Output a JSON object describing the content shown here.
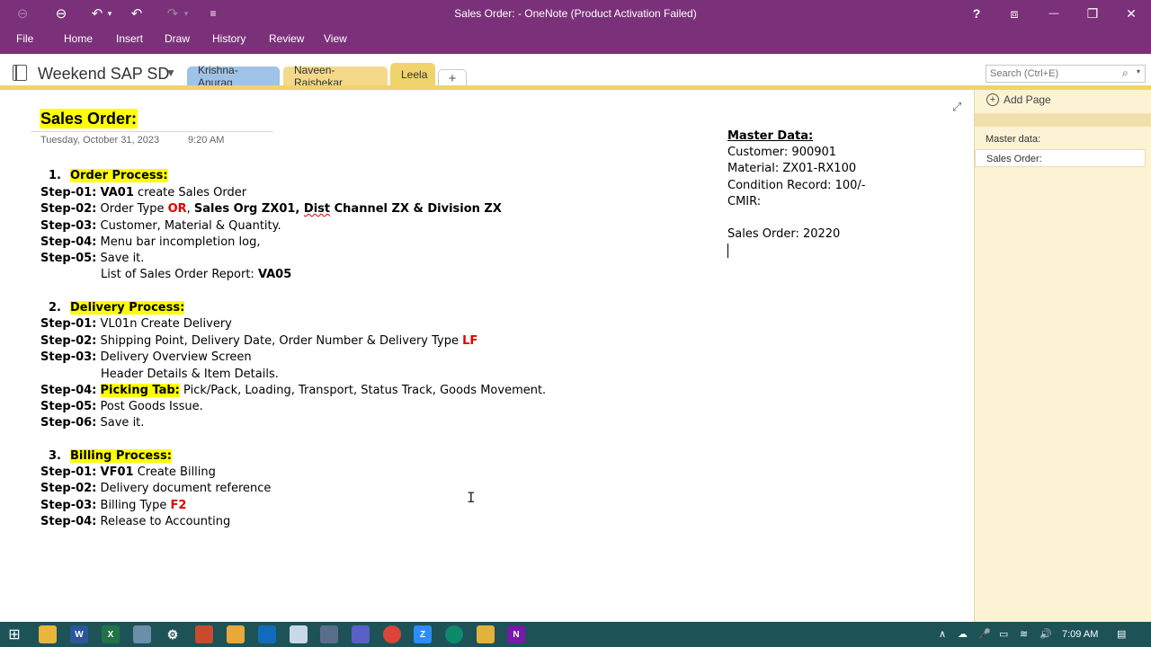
{
  "window": {
    "title": "Sales Order: - OneNote (Product Activation Failed)",
    "help_icon": "?",
    "restore_ribbon_icon": "⧈",
    "minimize_icon": "—",
    "maximize_icon": "❐",
    "close_icon": "✕"
  },
  "qat": {
    "back": "⊖",
    "undo": "↶",
    "undo_dd": "▾",
    "undo2": "↶",
    "redo": "↷",
    "redo_dd": "▾",
    "customize": "≡"
  },
  "ribbon": {
    "tabs": [
      "File",
      "Home",
      "Insert",
      "Draw",
      "History",
      "Review",
      "View"
    ]
  },
  "notebook": {
    "name": "Weekend SAP SD",
    "dropdown": "▼",
    "sections": [
      {
        "label": "Krishna-Anurag",
        "color": "#9fc3e6"
      },
      {
        "label": "Naveen-Rajshekar",
        "color": "#f4d98b"
      },
      {
        "label": "Leela",
        "color": "#f0d36b"
      }
    ],
    "add_section": "+"
  },
  "search": {
    "placeholder": "Search (Ctrl+E)",
    "icon": "⌕",
    "dropdown": "▾"
  },
  "page": {
    "expand_icon": "⤢",
    "title": "Sales Order:",
    "date": "Tuesday, October 31, 2023",
    "time": "9:20 AM",
    "order_num": "1.",
    "order_heading": "Order Process:",
    "s1_label": "Step-01:",
    "s1_code": "VA01",
    "s1_text": " create Sales Order",
    "s2_label": "Step-02:",
    "s2_a": " Order Type ",
    "s2_or": "OR",
    "s2_b": ", ",
    "s2_c": "Sales Org ZX01, ",
    "s2_d": "Dist",
    "s2_e": " Channel ZX & Division ZX",
    "s3_label": "Step-03:",
    "s3_text": " Customer, Material  & Quantity.",
    "s4_label": "Step-04:",
    "s4_text": " Menu bar incompletion log,",
    "s5_label": "Step-05:",
    "s5_text": " Save it.",
    "s5_sub": "List of Sales Order Report: ",
    "s5_sub_code": "VA05",
    "delivery_num": "2.",
    "delivery_heading": "Delivery Process:",
    "d1_label": "Step-01:",
    "d1_text": " VL01n Create Delivery",
    "d2_label": "Step-02:",
    "d2_text": " Shipping Point, Delivery Date, Order Number & Delivery Type ",
    "d2_lf": "LF",
    "d3_label": "Step-03:",
    "d3_text": " Delivery Overview Screen",
    "d3_sub": "Header Details & Item Details.",
    "d4_label": "Step-04:",
    "d4_hl": "Picking Tab:",
    "d4_text": " Pick/Pack, Loading, Transport, Status Track, Goods Movement.",
    "d5_label": "Step-05:",
    "d5_text": " Post Goods Issue.",
    "d6_label": "Step-06:",
    "d6_text": " Save it.",
    "billing_num": "3.",
    "billing_heading": "Billing Process:",
    "b1_label": "Step-01:",
    "b1_code": "VF01",
    "b1_text": " Create Billing",
    "b2_label": "Step-02:",
    "b2_text": " Delivery document reference",
    "b3_label": "Step-03:",
    "b3_text": " Billing Type ",
    "b3_f2": "F2",
    "b4_label": "Step-04:",
    "b4_text": " Release to Accounting"
  },
  "master": {
    "title": "Master Data:",
    "customer": "Customer: 900901",
    "material": "Material: ZX01-RX100",
    "condition": "Condition Record: 100/-",
    "cmir": "CMIR:",
    "sales_order": "Sales Order: 20220"
  },
  "pages_panel": {
    "add_icon": "+",
    "add_page": "Add Page",
    "items": [
      "Master data:",
      "Sales Order:"
    ]
  },
  "taskbar": {
    "start": "⊞",
    "apps": [
      "W",
      "X",
      "Z",
      "N"
    ],
    "tray_up": "∧",
    "time": "7:09 AM"
  }
}
